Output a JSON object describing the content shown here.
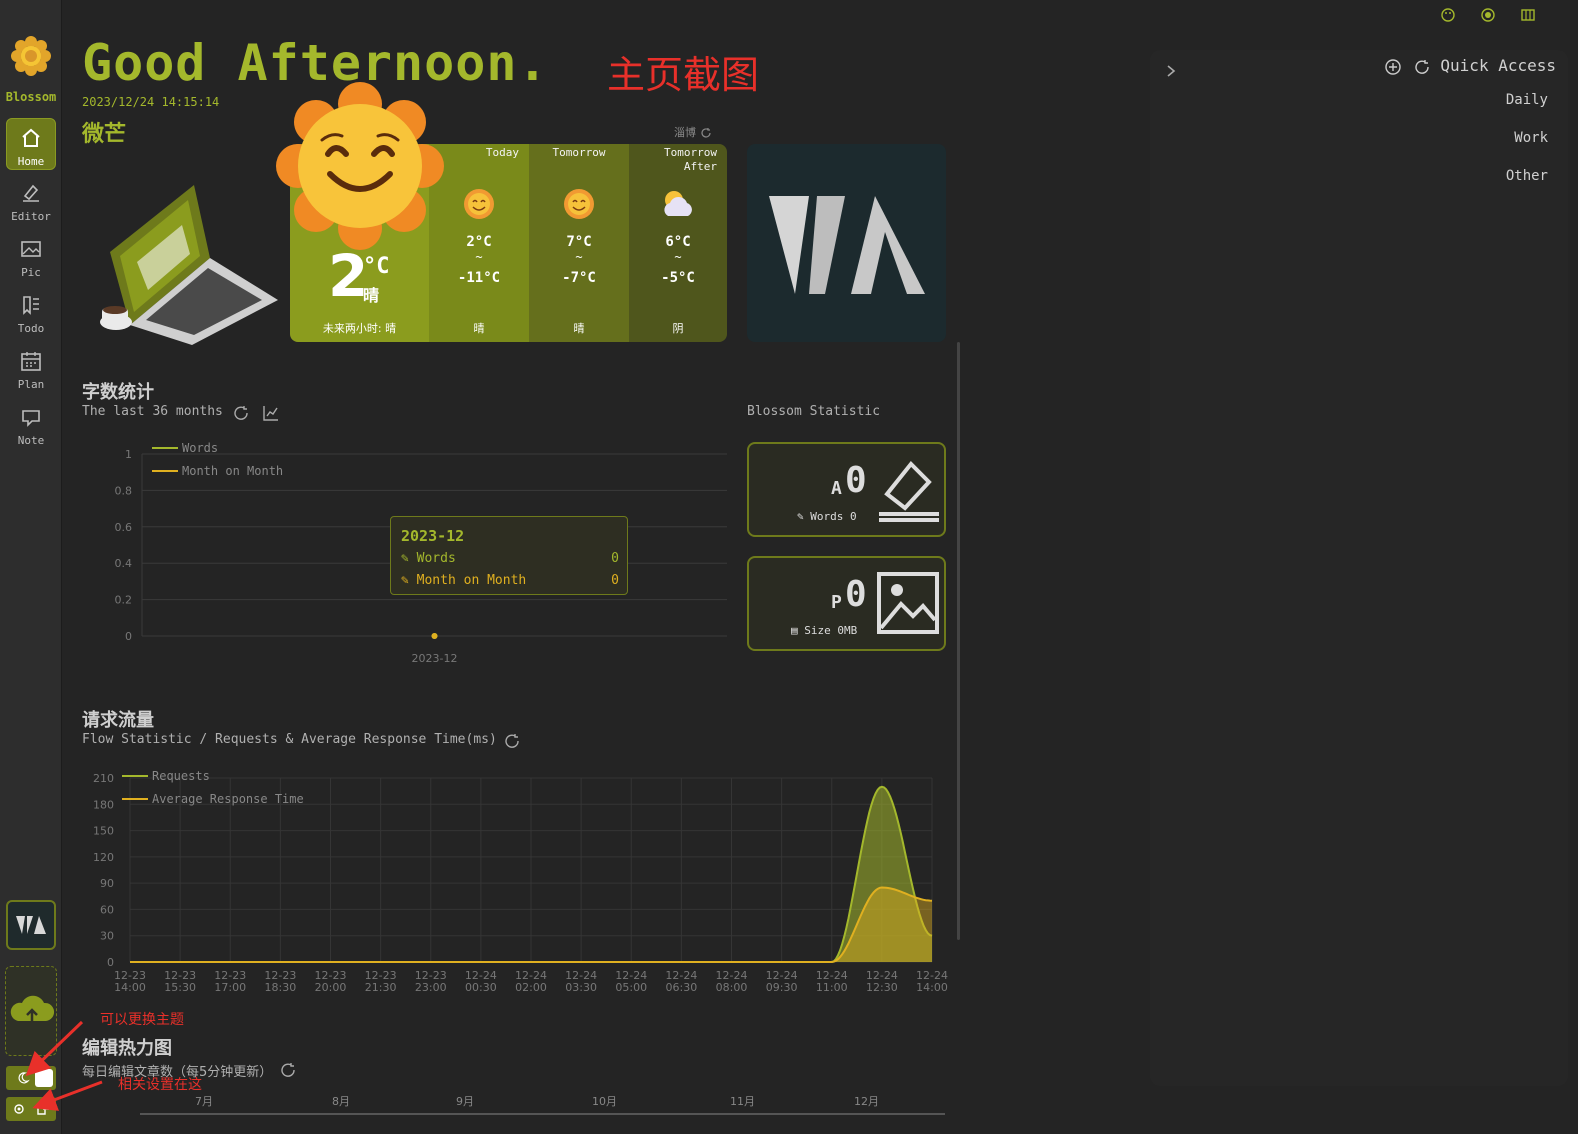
{
  "brand": {
    "name": "Blossom"
  },
  "nav": [
    {
      "label": "Home",
      "icon": "home-icon",
      "active": true
    },
    {
      "label": "Editor",
      "icon": "editor-icon"
    },
    {
      "label": "Pic",
      "icon": "picture-icon"
    },
    {
      "label": "Todo",
      "icon": "todo-icon"
    },
    {
      "label": "Plan",
      "icon": "calendar-icon"
    },
    {
      "label": "Note",
      "icon": "note-icon"
    }
  ],
  "header": {
    "greeting": "Good Afternoon.",
    "datetime": "2023/12/24 14:15:14",
    "nickname": "微芒",
    "annotation": "主页截图"
  },
  "weather": {
    "link": "淄博",
    "now": {
      "temp": "2",
      "unit": "°C",
      "cond": "晴",
      "forecast": "未来两小时: 晴"
    },
    "days": [
      {
        "label": "Today",
        "high": "2°C",
        "sep": "~",
        "low": "-11°C",
        "cond": "晴"
      },
      {
        "label": "Tomorrow",
        "high": "7°C",
        "sep": "~",
        "low": "-7°C",
        "cond": "晴"
      },
      {
        "label": "Tomorrow After",
        "high": "6°C",
        "sep": "~",
        "low": "-5°C",
        "cond": "阴"
      }
    ]
  },
  "word_stats": {
    "title": "字数统计",
    "subtitle": "The last 36 months",
    "tooltip": {
      "title": "2023-12",
      "rows": [
        {
          "label": "Words",
          "value": "0"
        },
        {
          "label": "Month on Month",
          "value": "0"
        }
      ]
    }
  },
  "blossom_stats": {
    "title": "Blossom Statistic",
    "words": {
      "prefix": "A",
      "value": "0",
      "label": "Words 0"
    },
    "pics": {
      "prefix": "P",
      "value": "0",
      "label": "Size 0MB"
    }
  },
  "flow": {
    "title": "请求流量",
    "subtitle": "Flow Statistic / Requests & Average Response Time(ms)"
  },
  "heatmap": {
    "title": "编辑热力图",
    "subtitle": "每日编辑文章数（每5分钟更新）",
    "months": [
      "7月",
      "8月",
      "9月",
      "10月",
      "11月",
      "12月"
    ]
  },
  "quick_access": {
    "title": "Quick Access",
    "items": [
      "Daily",
      "Work",
      "Other"
    ]
  },
  "annotations": {
    "theme": "可以更换主题",
    "settings": "相关设置在这"
  },
  "colors": {
    "accent": "#a4b82c",
    "accent_dark": "#6e7a1b",
    "line2": "#e0b020",
    "annotation": "#e8302a"
  },
  "chart_data": [
    {
      "type": "line",
      "title": "字数统计",
      "x": [
        "2023-12"
      ],
      "series": [
        {
          "name": "Words",
          "values": [
            0
          ]
        },
        {
          "name": "Month on Month",
          "values": [
            0
          ]
        }
      ],
      "yticks": [
        "1",
        "0.8",
        "0.6",
        "0.4",
        "0.2",
        "0"
      ],
      "ylim": [
        0,
        1
      ],
      "legend": "top-left"
    },
    {
      "type": "area",
      "title": "请求流量",
      "x": [
        "12-23 14:00",
        "12-23 15:30",
        "12-23 17:00",
        "12-23 18:30",
        "12-23 20:00",
        "12-23 21:30",
        "12-23 23:00",
        "12-24 00:30",
        "12-24 02:00",
        "12-24 03:30",
        "12-24 05:00",
        "12-24 06:30",
        "12-24 08:00",
        "12-24 09:30",
        "12-24 11:00",
        "12-24 12:30",
        "12-24 14:00"
      ],
      "series": [
        {
          "name": "Requests",
          "values": [
            0,
            0,
            0,
            0,
            0,
            0,
            0,
            0,
            0,
            0,
            0,
            0,
            0,
            0,
            0,
            200,
            30
          ]
        },
        {
          "name": "Average Response Time",
          "values": [
            0,
            0,
            0,
            0,
            0,
            0,
            0,
            0,
            0,
            0,
            0,
            0,
            0,
            0,
            0,
            85,
            70
          ]
        }
      ],
      "yticks": [
        "210",
        "180",
        "150",
        "120",
        "90",
        "60",
        "30",
        "0"
      ],
      "ylim": [
        0,
        210
      ],
      "legend": "top-left"
    }
  ]
}
